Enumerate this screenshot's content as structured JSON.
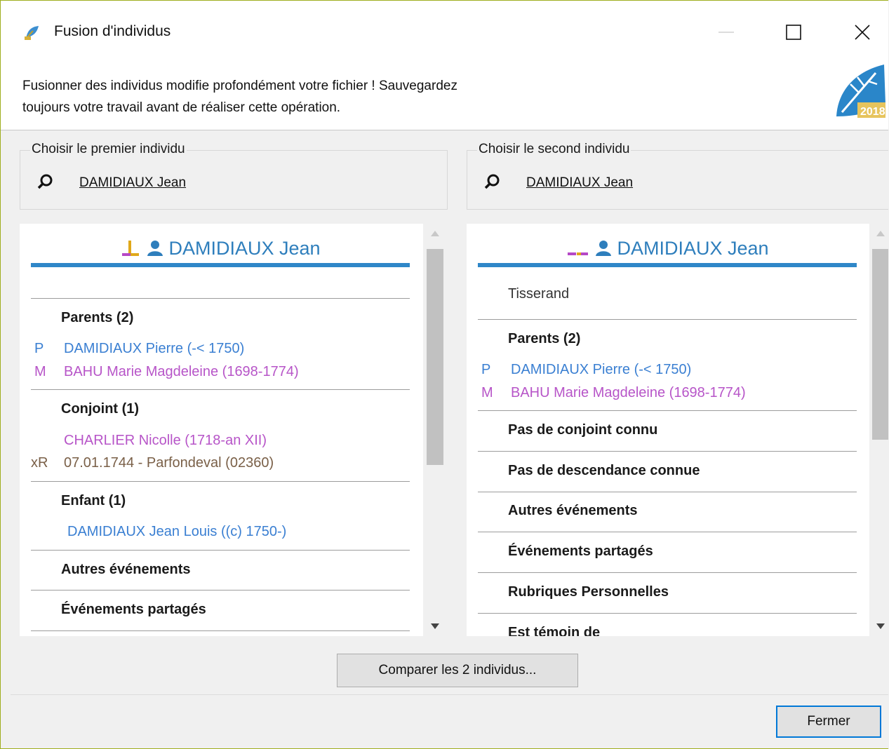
{
  "window": {
    "title": "Fusion d'individus"
  },
  "warning": {
    "line1": "Fusionner des individus modifie profondément votre fichier ! Sauvegardez",
    "line2": "toujours votre travail avant de réaliser cette opération."
  },
  "logo": {
    "badge": "2018"
  },
  "colors": {
    "accent": "#2f87c8",
    "male": "#3a7fd2",
    "female": "#b755c8",
    "close_focus": "#0078d7"
  },
  "first": {
    "legend": "Choisir le premier individu",
    "selected": "DAMIDIAUX Jean",
    "card": {
      "name": "DAMIDIAUX Jean",
      "parents_title": "Parents (2)",
      "father_prefix": "P",
      "father": "DAMIDIAUX Pierre (-< 1750)",
      "mother_prefix": "M",
      "mother": "BAHU Marie Magdeleine (1698-1774)",
      "spouse_title": "Conjoint (1)",
      "spouse": "CHARLIER Nicolle (1718-an XII)",
      "marriage_prefix": "xR",
      "marriage": "07.01.1744 - Parfondeval (02360)",
      "children_title": "Enfant (1)",
      "child": "DAMIDIAUX Jean Louis ((c) 1750-)",
      "other_events": "Autres événements",
      "shared_events": "Événements partagés"
    }
  },
  "second": {
    "legend": "Choisir le second individu",
    "selected": "DAMIDIAUX Jean",
    "card": {
      "name": "DAMIDIAUX Jean",
      "occupation": "Tisserand",
      "parents_title": "Parents (2)",
      "father_prefix": "P",
      "father": "DAMIDIAUX Pierre (-< 1750)",
      "mother_prefix": "M",
      "mother": "BAHU Marie Magdeleine (1698-1774)",
      "no_spouse": "Pas de conjoint connu",
      "no_descendants": "Pas de descendance connue",
      "other_events": "Autres événements",
      "shared_events": "Événements partagés",
      "personal_sections": "Rubriques Personnelles",
      "witness_of": "Est témoin de"
    }
  },
  "buttons": {
    "compare": "Comparer les 2 individus...",
    "close": "Fermer"
  }
}
